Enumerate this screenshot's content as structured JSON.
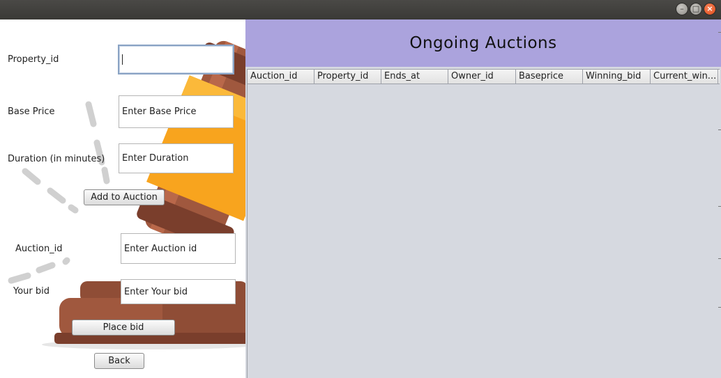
{
  "window": {
    "controls": [
      "minimize-icon",
      "maximize-icon",
      "close-icon"
    ]
  },
  "form": {
    "property_id_label": "Property_id",
    "property_id_value": "",
    "base_price_label": "Base Price",
    "base_price_placeholder": "Enter Base Price",
    "duration_label": "Duration (in minutes)",
    "duration_placeholder": "Enter Duration",
    "add_button": "Add to Auction",
    "auction_id_label": "Auction_id",
    "auction_id_placeholder": "Enter Auction id",
    "bid_label": "Your bid",
    "bid_placeholder": "Enter Your bid",
    "place_bid_button": "Place bid",
    "back_button": "Back"
  },
  "auctions": {
    "title": "Ongoing Auctions",
    "columns": [
      "Auction_id",
      "Property_id",
      "Ends_at",
      "Owner_id",
      "Baseprice",
      "Winning_bid",
      "Current_win..."
    ],
    "rows": []
  },
  "colors": {
    "header_bg": "#aba3dd",
    "table_bg": "#d6d9e0",
    "gavel_brown": "#a0583e",
    "gavel_orange": "#f8a41e"
  }
}
